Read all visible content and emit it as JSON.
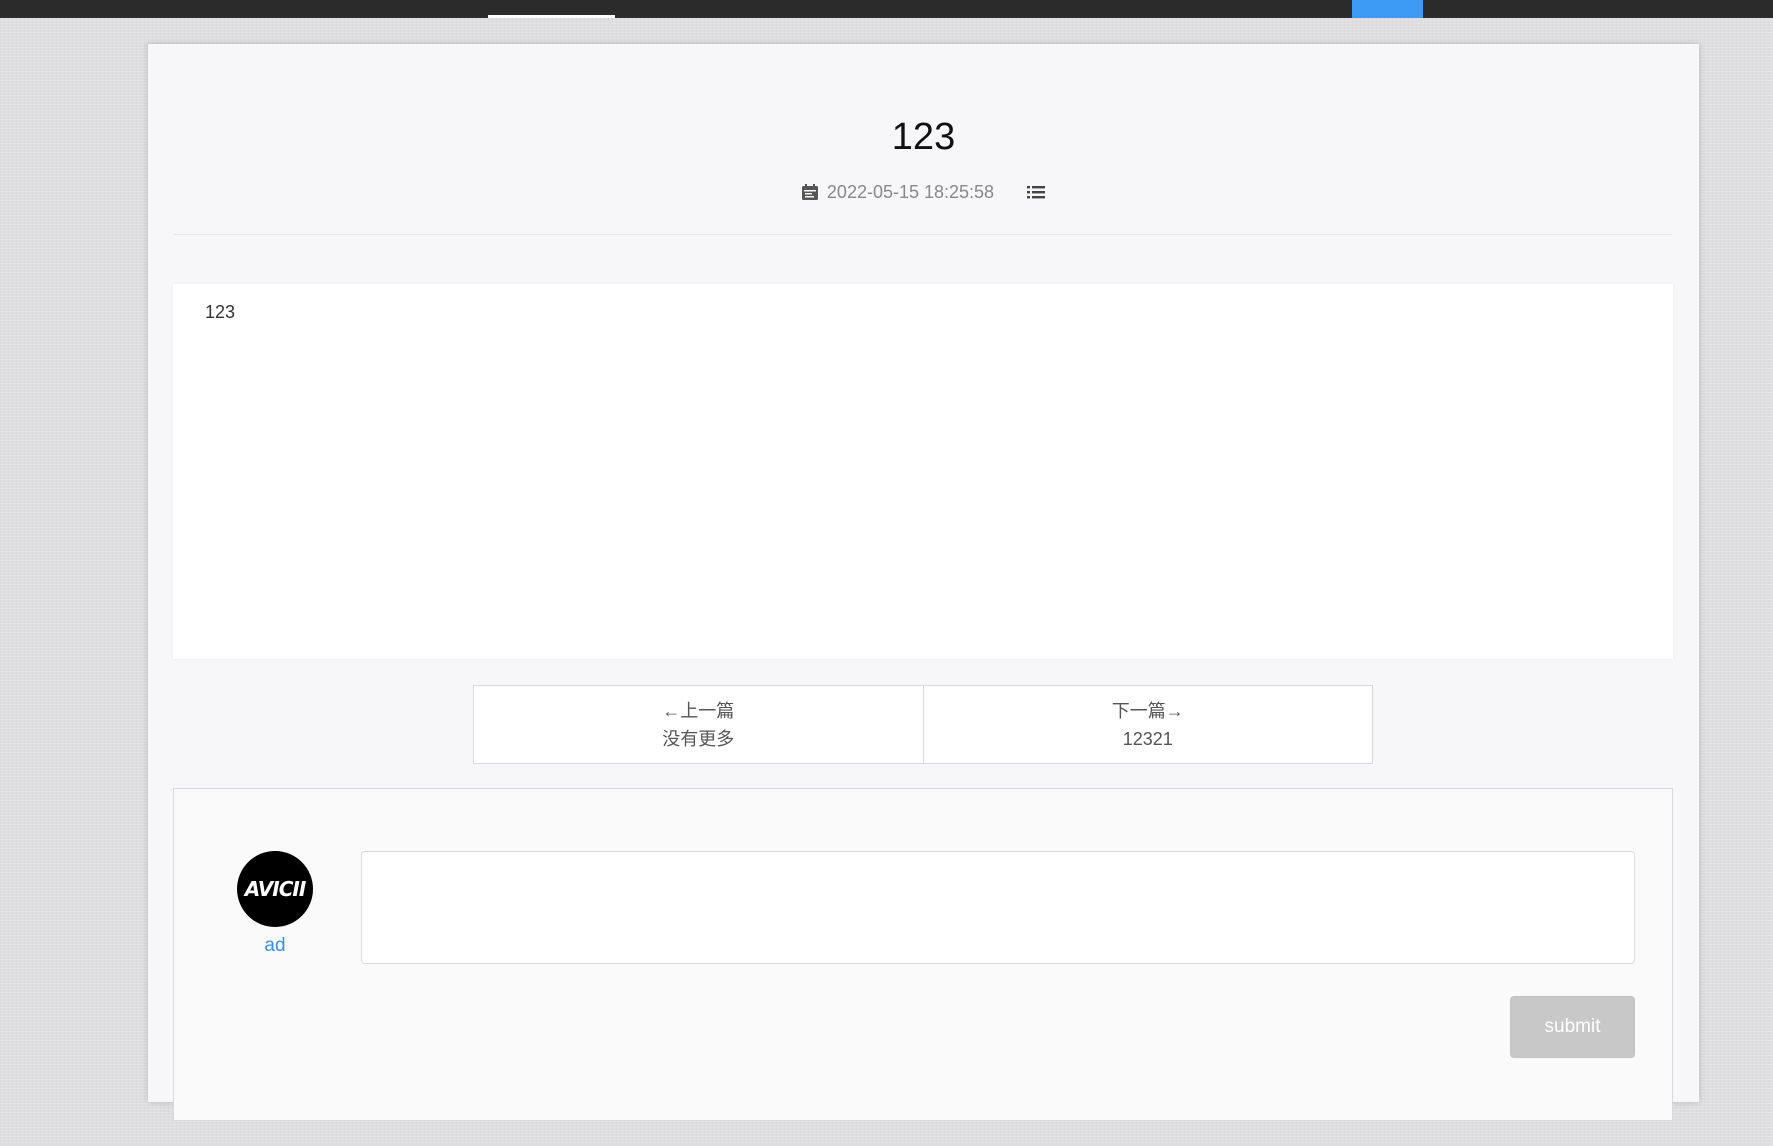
{
  "article": {
    "title": "123",
    "date": "2022-05-15 18:25:58",
    "content": "123",
    "icons": [
      "calendar-icon",
      "list-icon"
    ]
  },
  "pager": {
    "prev_label": "←上一篇",
    "prev_title": "没有更多",
    "next_label": "下一篇→",
    "next_title": "12321"
  },
  "comment": {
    "avatar_text": "AVICII",
    "username": "ad",
    "input_placeholder": "",
    "submit_label": "submit"
  },
  "colors": {
    "topbar": "#2b2b2b",
    "nav_active": "#3d9bf5",
    "username_link": "#3d8ee6",
    "submit_disabled": "#c8c8c8"
  }
}
